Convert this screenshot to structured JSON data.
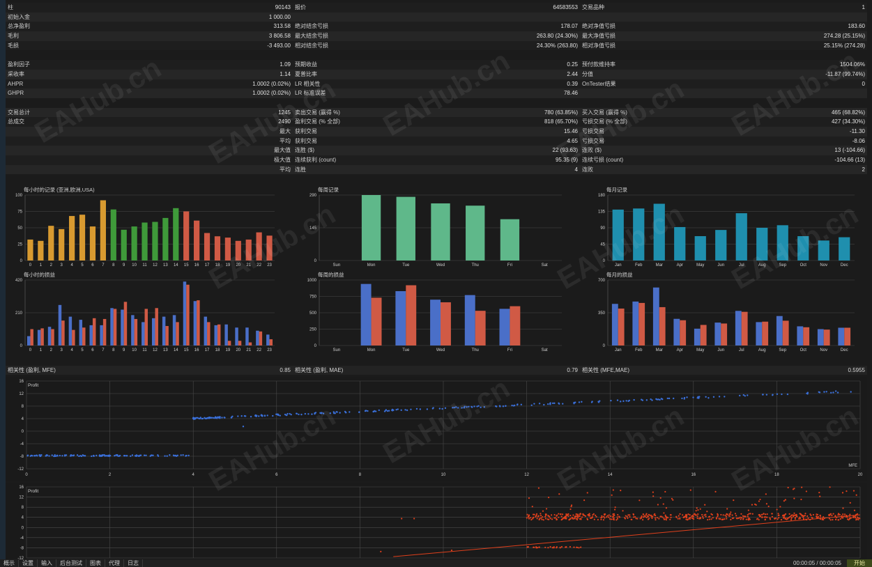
{
  "stats_rows": [
    [
      [
        "柱",
        "90143"
      ],
      [
        "报价",
        "64583553"
      ],
      [
        "交易品种",
        "1"
      ]
    ],
    [
      [
        "初始入金",
        "1 000.00"
      ],
      [
        "",
        ""
      ],
      [
        "",
        ""
      ]
    ],
    [
      [
        "总净盈利",
        "313.58"
      ],
      [
        "绝对结余亏损",
        "178.07"
      ],
      [
        "绝对净值亏损",
        "183.60"
      ]
    ],
    [
      [
        "毛利",
        "3 806.58"
      ],
      [
        "最大结余亏损",
        "263.80 (24.30%)"
      ],
      [
        "最大净值亏损",
        "274.28 (25.15%)"
      ]
    ],
    [
      [
        "毛损",
        "-3 493.00"
      ],
      [
        "相对结余亏损",
        "24.30% (263.80)"
      ],
      [
        "相对净值亏损",
        "25.15% (274.28)"
      ]
    ],
    null,
    [
      [
        "盈利因子",
        "1.09"
      ],
      [
        "预期收益",
        "0.25"
      ],
      [
        "预付款维持率",
        "1504.06%"
      ]
    ],
    [
      [
        "采收率",
        "1.14"
      ],
      [
        "夏普比率",
        "2.44"
      ],
      [
        "分值",
        "-11.87 (99.74%)"
      ]
    ],
    [
      [
        "AHPR",
        "1.0002 (0.02%)"
      ],
      [
        "LR 相关性",
        "0.39"
      ],
      [
        "OnTester结果",
        "0"
      ]
    ],
    [
      [
        "GHPR",
        "1.0002 (0.02%)"
      ],
      [
        "LR 标准误差",
        "78.46"
      ],
      [
        "",
        ""
      ]
    ],
    null,
    [
      [
        "交易总计",
        "1245"
      ],
      [
        "卖出交易 (赢得 %)",
        "780 (63.85%)"
      ],
      [
        "买入交易 (赢得 %)",
        "465 (68.82%)"
      ]
    ],
    [
      [
        "总成交",
        "2490"
      ],
      [
        "盈利交易 (% 全部)",
        "818 (65.70%)"
      ],
      [
        "亏损交易 (% 全部)",
        "427 (34.30%)"
      ]
    ],
    [
      [
        "最大",
        "",
        true
      ],
      [
        "获利交易",
        "15.46"
      ],
      [
        "亏损交易",
        "-11.30"
      ]
    ],
    [
      [
        "平均",
        "",
        true
      ],
      [
        "获利交易",
        "4.65"
      ],
      [
        "亏损交易",
        "-8.06"
      ]
    ],
    [
      [
        "最大值",
        "",
        true
      ],
      [
        "连胜 ($)",
        "22 (93.63)"
      ],
      [
        "连败 ($)",
        "13 (-104.66)"
      ]
    ],
    [
      [
        "极大值",
        "",
        true
      ],
      [
        "连续获利 (count)",
        "95.35 (9)"
      ],
      [
        "连续亏损 (count)",
        "-104.66 (13)"
      ]
    ],
    [
      [
        "平均",
        "",
        true
      ],
      [
        "连胜",
        "4"
      ],
      [
        "连败",
        "2"
      ]
    ]
  ],
  "colors": {
    "orange": "#d89a30",
    "green": "#3f9a3a",
    "red": "#d05a45",
    "blue": "#4a6fc8",
    "teal": "#1f8fae",
    "mint": "#5fb88a",
    "scatter_blue": "#3a6fd8",
    "scatter_red": "#e0401c"
  },
  "chart_data": [
    {
      "type": "bar",
      "title": "每小时的记录 (亚洲,欧洲,USA)",
      "categories": [
        "0",
        "1",
        "2",
        "3",
        "4",
        "5",
        "6",
        "7",
        "8",
        "9",
        "10",
        "11",
        "12",
        "13",
        "14",
        "15",
        "16",
        "17",
        "18",
        "19",
        "20",
        "21",
        "22",
        "23"
      ],
      "values": [
        32,
        30,
        53,
        48,
        68,
        70,
        52,
        92,
        78,
        47,
        52,
        58,
        59,
        65,
        80,
        75,
        61,
        42,
        37,
        35,
        30,
        32,
        43,
        38
      ],
      "ylim": [
        0,
        100
      ],
      "yticks": [
        "0",
        "25",
        "50",
        "75",
        "100"
      ]
    },
    {
      "type": "bar",
      "title": "每周记录",
      "categories": [
        "Sun",
        "Mon",
        "Tue",
        "Wed",
        "Thu",
        "Fri",
        "Sat"
      ],
      "values": [
        0,
        290,
        282,
        253,
        243,
        183,
        0
      ],
      "ylim": [
        0,
        290
      ],
      "yticks": [
        "0",
        "145",
        "290"
      ]
    },
    {
      "type": "bar",
      "title": "每月记录",
      "categories": [
        "Jan",
        "Feb",
        "Mar",
        "Apr",
        "May",
        "Jun",
        "Jul",
        "Aug",
        "Sep",
        "Oct",
        "Nov",
        "Dec"
      ],
      "values": [
        140,
        143,
        156,
        92,
        67,
        84,
        130,
        90,
        97,
        67,
        55,
        64
      ],
      "ylim": [
        0,
        180
      ],
      "yticks": [
        "0",
        "45",
        "90",
        "135",
        "180"
      ]
    },
    {
      "type": "bar",
      "title": "每小时的损益",
      "categories": [
        "0",
        "1",
        "2",
        "3",
        "4",
        "5",
        "6",
        "7",
        "8",
        "9",
        "10",
        "11",
        "12",
        "13",
        "14",
        "15",
        "16",
        "17",
        "18",
        "19",
        "20",
        "21",
        "22",
        "23"
      ],
      "series": [
        {
          "values": [
            60,
            100,
            120,
            260,
            185,
            165,
            130,
            130,
            240,
            230,
            195,
            150,
            175,
            185,
            195,
            410,
            285,
            185,
            130,
            135,
            115,
            115,
            95,
            70
          ]
        },
        {
          "values": [
            105,
            110,
            105,
            160,
            100,
            115,
            175,
            170,
            235,
            280,
            170,
            235,
            240,
            125,
            150,
            390,
            290,
            150,
            135,
            30,
            30,
            20,
            90,
            40
          ]
        }
      ],
      "ylim": [
        0,
        420
      ],
      "yticks": [
        "0",
        "210",
        "420"
      ]
    },
    {
      "type": "bar",
      "title": "每周的损益",
      "categories": [
        "Sun",
        "Mon",
        "Tue",
        "Wed",
        "Thu",
        "Fri",
        "Sat"
      ],
      "series": [
        {
          "values": [
            0,
            940,
            830,
            700,
            770,
            560,
            0
          ]
        },
        {
          "values": [
            0,
            730,
            920,
            660,
            530,
            600,
            0
          ]
        }
      ],
      "ylim": [
        0,
        1000
      ],
      "yticks": [
        "0",
        "250",
        "500",
        "750",
        "1000"
      ]
    },
    {
      "type": "bar",
      "title": "每月的损益",
      "categories": [
        "Jan",
        "Feb",
        "Mar",
        "Apr",
        "May",
        "Jun",
        "Jul",
        "Aug",
        "Sep",
        "Oct",
        "Nov",
        "Dec"
      ],
      "series": [
        {
          "values": [
            445,
            470,
            620,
            285,
            180,
            245,
            370,
            250,
            315,
            205,
            175,
            190
          ]
        },
        {
          "values": [
            395,
            455,
            410,
            270,
            220,
            235,
            360,
            255,
            265,
            195,
            170,
            190
          ]
        }
      ],
      "ylim": [
        0,
        700
      ],
      "yticks": [
        "0",
        "350",
        "700"
      ]
    },
    {
      "type": "scatter",
      "title": "Profit",
      "xlabel": "MFE",
      "xlim": [
        0,
        20
      ],
      "ylim": [
        -12,
        16
      ],
      "xticks": [
        "0",
        "2",
        "4",
        "6",
        "8",
        "10",
        "12",
        "14",
        "16",
        "18",
        "20"
      ],
      "yticks": [
        "-12",
        "-8",
        "-4",
        "0",
        "4",
        "8",
        "12",
        "16"
      ]
    },
    {
      "type": "scatter",
      "title": "Profit",
      "xlim": [
        0,
        20
      ],
      "ylim": [
        -12,
        16
      ],
      "yticks": [
        "-12",
        "-8",
        "-4",
        "0",
        "4",
        "8",
        "12",
        "16"
      ]
    }
  ],
  "correlation": [
    [
      "相关性 (盈利, MFE)",
      "0.85"
    ],
    [
      "相关性 (盈利, MAE)",
      "0.79"
    ],
    [
      "相关性 (MFE,MAE)",
      "0.5955"
    ]
  ],
  "tabs": [
    "概示",
    "设置",
    "输入",
    "后台测试",
    "图表",
    "代理",
    "日志"
  ],
  "status": "00:00:05 / 00:00:05",
  "start_button": "开始",
  "watermark": "EAHub.cn"
}
